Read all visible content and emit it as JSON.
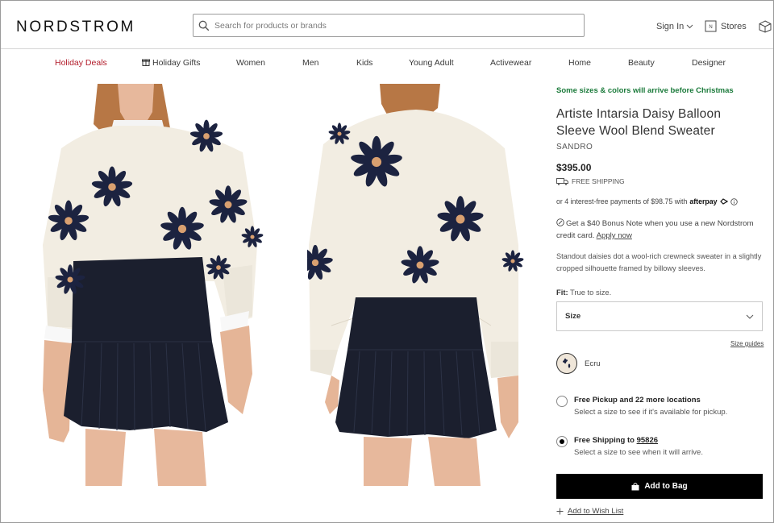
{
  "header": {
    "logo": "NORDSTROM",
    "search_placeholder": "Search for products or brands",
    "sign_in": "Sign In",
    "stores": "Stores"
  },
  "nav": {
    "items": [
      "Holiday Deals",
      "Holiday Gifts",
      "Women",
      "Men",
      "Kids",
      "Young Adult",
      "Activewear",
      "Home",
      "Beauty",
      "Designer"
    ]
  },
  "product": {
    "promo": "Some sizes & colors will arrive before Christmas",
    "title": "Artiste Intarsia Daisy Balloon Sleeve Wool Blend Sweater",
    "brand": "SANDRO",
    "price": "$395.00",
    "free_shipping": "FREE SHIPPING",
    "afterpay_text": "or 4 interest-free payments of $98.75 with",
    "afterpay_brand": "afterpay",
    "bonus_text": "Get a $40 Bonus Note when you use a new Nordstrom credit card.",
    "bonus_link": "Apply now",
    "description": "Standout daisies dot a wool-rich crewneck sweater in a slightly cropped silhouette framed by billowy sleeves.",
    "fit_label": "Fit:",
    "fit_value": "True to size.",
    "size_label": "Size",
    "size_guides": "Size guides",
    "color": "Ecru",
    "pickup_head": "Free Pickup and 22 more locations",
    "pickup_sub": "Select a size to see if it's available for pickup.",
    "shipping_head": "Free Shipping to",
    "shipping_zip": "95826",
    "shipping_sub": "Select a size to see when it will arrive.",
    "add_to_bag": "Add to Bag",
    "wish_list": "Add to Wish List"
  },
  "colors": {
    "deal_red": "#b21b2a",
    "promo_green": "#1a7a3a",
    "navy": "#1c2340",
    "ecru": "#efe6d9"
  }
}
